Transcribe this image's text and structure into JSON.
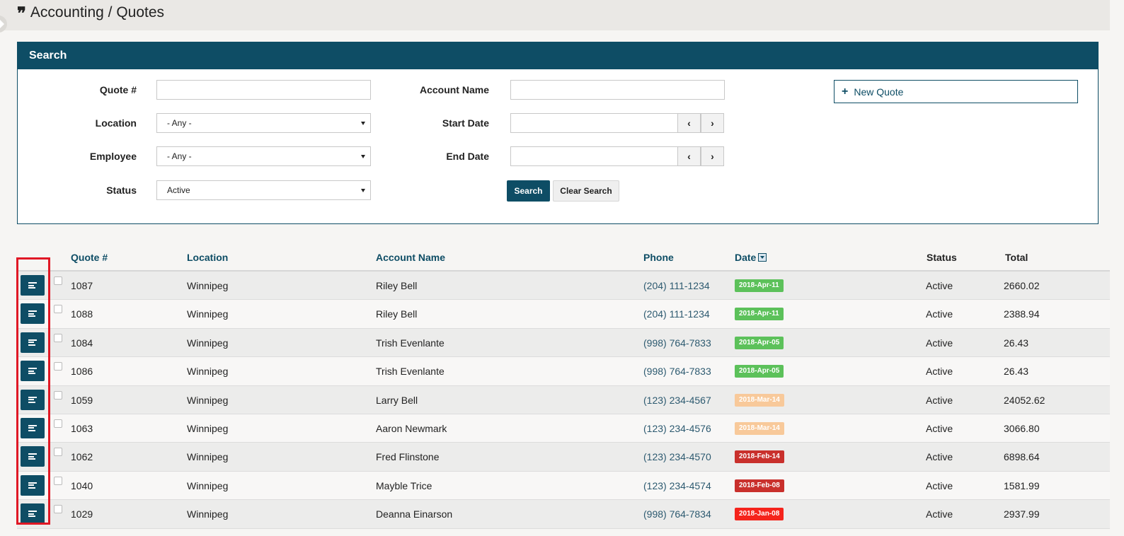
{
  "header": {
    "title": "Accounting / Quotes"
  },
  "search": {
    "title": "Search",
    "quote_label": "Quote #",
    "quote_value": "",
    "location_label": "Location",
    "location_value": "- Any -",
    "employee_label": "Employee",
    "employee_value": "- Any -",
    "status_label": "Status",
    "status_value": "Active",
    "account_label": "Account Name",
    "account_value": "",
    "start_label": "Start Date",
    "start_value": "",
    "end_label": "End Date",
    "end_value": "",
    "search_button": "Search",
    "clear_button": "Clear Search",
    "new_quote_button": "New Quote"
  },
  "table": {
    "columns": [
      "Quote #",
      "Location",
      "Account Name",
      "Phone",
      "Date",
      "Status",
      "Total"
    ],
    "rows": [
      {
        "quote": "1087",
        "location": "Winnipeg",
        "account": "Riley Bell",
        "phone": "(204) 111-1234",
        "date": "2018-Apr-11",
        "date_color": "#5cc15a",
        "status": "Active",
        "total": "2660.02"
      },
      {
        "quote": "1088",
        "location": "Winnipeg",
        "account": "Riley Bell",
        "phone": "(204) 111-1234",
        "date": "2018-Apr-11",
        "date_color": "#5cc15a",
        "status": "Active",
        "total": "2388.94"
      },
      {
        "quote": "1084",
        "location": "Winnipeg",
        "account": "Trish Evenlante",
        "phone": "(998) 764-7833",
        "date": "2018-Apr-05",
        "date_color": "#5cc15a",
        "status": "Active",
        "total": "26.43"
      },
      {
        "quote": "1086",
        "location": "Winnipeg",
        "account": "Trish Evenlante",
        "phone": "(998) 764-7833",
        "date": "2018-Apr-05",
        "date_color": "#5cc15a",
        "status": "Active",
        "total": "26.43"
      },
      {
        "quote": "1059",
        "location": "Winnipeg",
        "account": "Larry Bell",
        "phone": "(123) 234-4567",
        "date": "2018-Mar-14",
        "date_color": "#f8c99a",
        "status": "Active",
        "total": "24052.62"
      },
      {
        "quote": "1063",
        "location": "Winnipeg",
        "account": "Aaron Newmark",
        "phone": "(123) 234-4576",
        "date": "2018-Mar-14",
        "date_color": "#f8c99a",
        "status": "Active",
        "total": "3066.80"
      },
      {
        "quote": "1062",
        "location": "Winnipeg",
        "account": "Fred Flinstone",
        "phone": "(123) 234-4570",
        "date": "2018-Feb-14",
        "date_color": "#c9302c",
        "status": "Active",
        "total": "6898.64"
      },
      {
        "quote": "1040",
        "location": "Winnipeg",
        "account": "Mayble Trice",
        "phone": "(123) 234-4574",
        "date": "2018-Feb-08",
        "date_color": "#c9302c",
        "status": "Active",
        "total": "1581.99"
      },
      {
        "quote": "1029",
        "location": "Winnipeg",
        "account": "Deanna Einarson",
        "phone": "(998) 764-7834",
        "date": "2018-Jan-08",
        "date_color": "#f5241c",
        "status": "Active",
        "total": "2937.99"
      }
    ]
  },
  "colors": {
    "primary": "#0e4d65",
    "highlight": "#e01825"
  }
}
